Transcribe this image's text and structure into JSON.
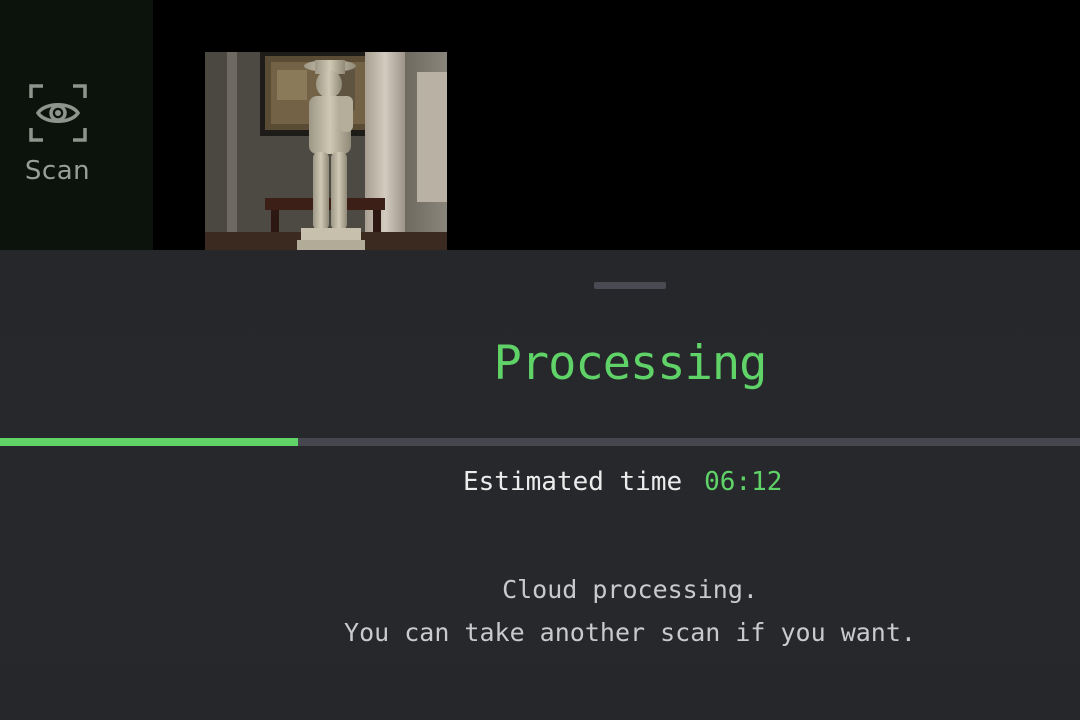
{
  "sidebar": {
    "scan": {
      "label": "Scan",
      "icon": "scan-eye-icon"
    }
  },
  "sheet": {
    "title": "Processing",
    "progress": 0.276,
    "estimated_label": "Estimated time",
    "estimated_value": "06:12",
    "message_line1": "Cloud processing.",
    "message_line2": "You can take another scan if you want."
  },
  "colors": {
    "accent": "#5fd367",
    "sheet_bg": "#27282c",
    "track": "#45464e"
  }
}
